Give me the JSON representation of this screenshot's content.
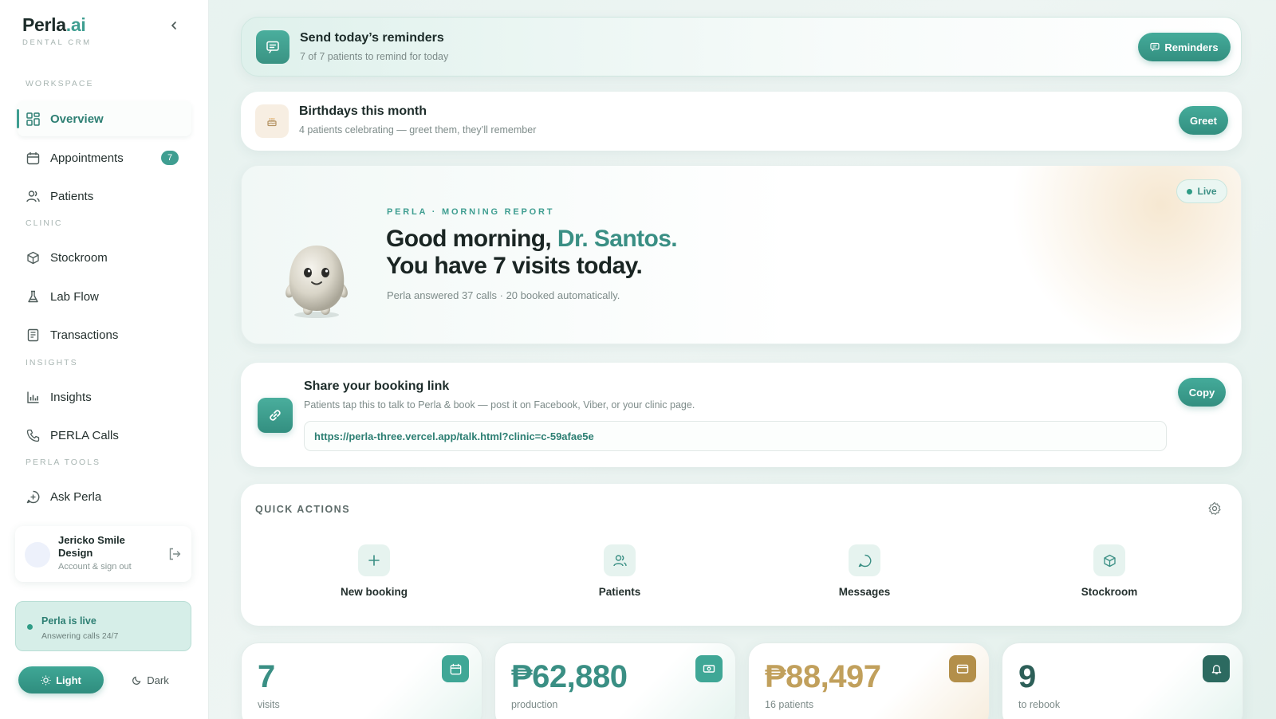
{
  "brand": {
    "name": "Perla",
    "suffix": ".ai",
    "subtitle": "DENTAL CRM"
  },
  "sidebar": {
    "sections": {
      "workspace": "WORKSPACE",
      "clinic": "CLINIC",
      "insights": "INSIGHTS",
      "perla_tools": "PERLA TOOLS"
    },
    "items": [
      {
        "label": "Overview",
        "icon": "grid-icon",
        "active": true
      },
      {
        "label": "Appointments",
        "icon": "calendar-icon",
        "badge": "7"
      },
      {
        "label": "Patients",
        "icon": "users-icon"
      },
      {
        "label": "Stockroom",
        "icon": "box-icon"
      },
      {
        "label": "Lab Flow",
        "icon": "flask-icon"
      },
      {
        "label": "Transactions",
        "icon": "receipt-icon"
      },
      {
        "label": "Insights",
        "icon": "bar-chart-icon"
      },
      {
        "label": "PERLA Calls",
        "icon": "phone-icon"
      },
      {
        "label": "Ask Perla",
        "icon": "chat-icon"
      }
    ],
    "account": {
      "name": "Jericko Smile Design",
      "sub": "Account & sign out"
    },
    "live": {
      "title": "Perla is live",
      "sub": "Answering calls 24/7"
    },
    "theme": {
      "light": "Light",
      "dark": "Dark",
      "selected": "Light"
    }
  },
  "reminders": {
    "title": "Send today’s reminders",
    "sub": "7 of 7 patients to remind for today",
    "button": "Reminders"
  },
  "birthdays": {
    "title": "Birthdays this month",
    "sub": "4 patients celebrating — greet them, they’ll remember",
    "button": "Greet"
  },
  "hero": {
    "eyebrow": "PERLA · MORNING REPORT",
    "greeting": "Good morning,",
    "doctor": "Dr. Santos.",
    "line2": "You have 7 visits today.",
    "sub": "Perla answered 37 calls · 20 booked automatically.",
    "badge": "Live"
  },
  "share": {
    "title": "Share your booking link",
    "sub": "Patients tap this to talk to Perla & book — post it on Facebook, Viber, or your clinic page.",
    "url": "https://perla-three.vercel.app/talk.html?clinic=c-59afae5e",
    "button": "Copy"
  },
  "quick_actions": {
    "label": "QUICK ACTIONS",
    "items": [
      {
        "label": "New booking",
        "icon": "plus-icon"
      },
      {
        "label": "Patients",
        "icon": "users-icon"
      },
      {
        "label": "Messages",
        "icon": "message-icon"
      },
      {
        "label": "Stockroom",
        "icon": "box-icon"
      }
    ]
  },
  "stats": [
    {
      "value": "7",
      "label": "visits",
      "color": "#3a8f84",
      "icon_bg": "#3fa796"
    },
    {
      "value": "₱62,880",
      "label": "production",
      "color": "#3a8f84",
      "icon_bg": "#3fa796"
    },
    {
      "value": "₱88,497",
      "label": "16 patients",
      "color": "#c1a05c",
      "icon_bg": "#b38f4a"
    },
    {
      "value": "9",
      "label": "to rebook",
      "color": "#2d5f58",
      "icon_bg": "#2c6a60"
    }
  ]
}
